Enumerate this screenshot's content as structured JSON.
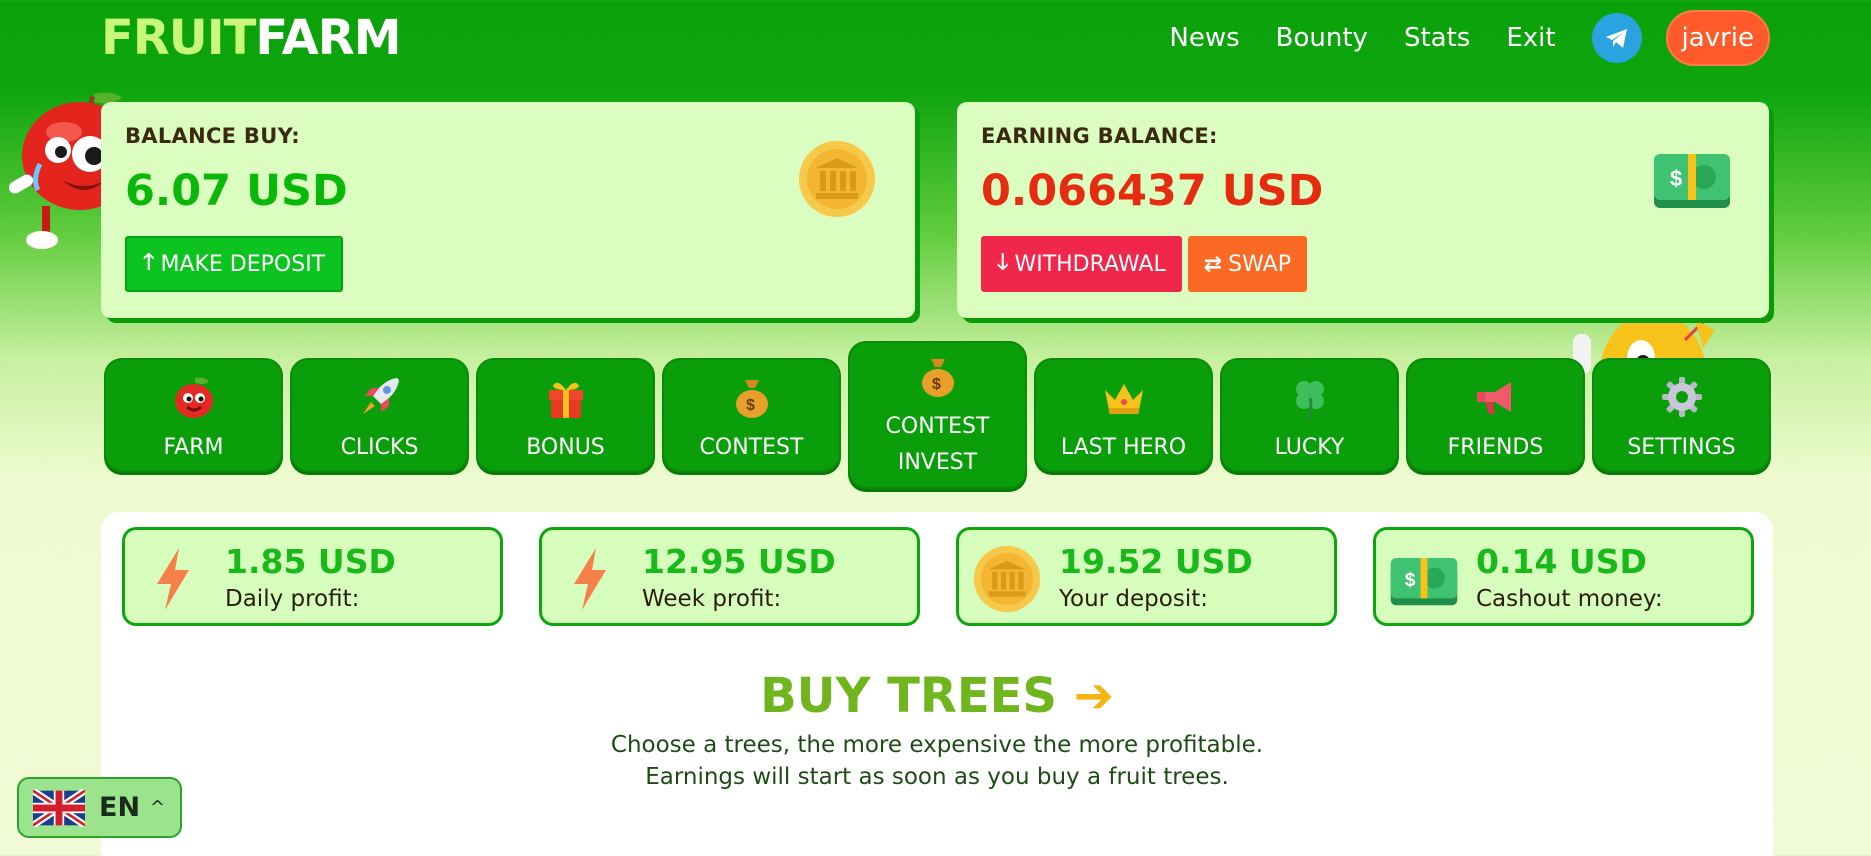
{
  "header": {
    "logo_part1": "FRUIT",
    "logo_part2": "FARM",
    "nav": [
      "News",
      "Bounty",
      "Stats",
      "Exit"
    ],
    "telegram_icon": "telegram-icon",
    "username": "javrie"
  },
  "balance_buy": {
    "label": "BALANCE BUY:",
    "amount": "6.07 USD",
    "deposit_button": "MAKE DEPOSIT",
    "icon": "bank-coin-icon"
  },
  "earning_balance": {
    "label": "EARNING BALANCE:",
    "amount": "0.066437 USD",
    "withdraw_button": "WITHDRAWAL",
    "swap_button": "SWAP",
    "icon": "cash-stack-icon"
  },
  "menu": [
    {
      "label": "FARM",
      "icon": "apple-icon"
    },
    {
      "label": "CLICKS",
      "icon": "rocket-icon"
    },
    {
      "label": "BONUS",
      "icon": "gift-icon"
    },
    {
      "label": "CONTEST",
      "icon": "money-bag-icon"
    },
    {
      "label": "CONTEST INVEST",
      "icon": "money-bag-icon",
      "active": true
    },
    {
      "label": "LAST HERO",
      "icon": "crown-icon"
    },
    {
      "label": "LUCKY",
      "icon": "clover-icon"
    },
    {
      "label": "FRIENDS",
      "icon": "megaphone-icon"
    },
    {
      "label": "SETTINGS",
      "icon": "gear-icon"
    }
  ],
  "stats": [
    {
      "value": "1.85 USD",
      "label": "Daily profit:",
      "icon": "lightning-icon"
    },
    {
      "value": "12.95 USD",
      "label": "Week profit:",
      "icon": "lightning-icon"
    },
    {
      "value": "19.52 USD",
      "label": "Your deposit:",
      "icon": "bank-coin-icon"
    },
    {
      "value": "0.14 USD",
      "label": "Cashout money:",
      "icon": "cash-stack-icon"
    }
  ],
  "buy_trees": {
    "title": "BUY TREES",
    "arrow": "➔",
    "line1": "Choose a trees, the more expensive the more profitable.",
    "line2": "Earnings will start as soon as you buy a fruit trees."
  },
  "language": {
    "code": "EN",
    "flag_icon": "uk-flag-icon",
    "chevron": "^"
  },
  "colors": {
    "header_green": "#0aa10a",
    "card_bg": "#dbfdbf",
    "deposit_green": "#0cc31f",
    "withdraw_red": "#f0264a",
    "swap_orange": "#fa6a24",
    "earning_red": "#e52b10",
    "title_green": "#6fb51e"
  }
}
